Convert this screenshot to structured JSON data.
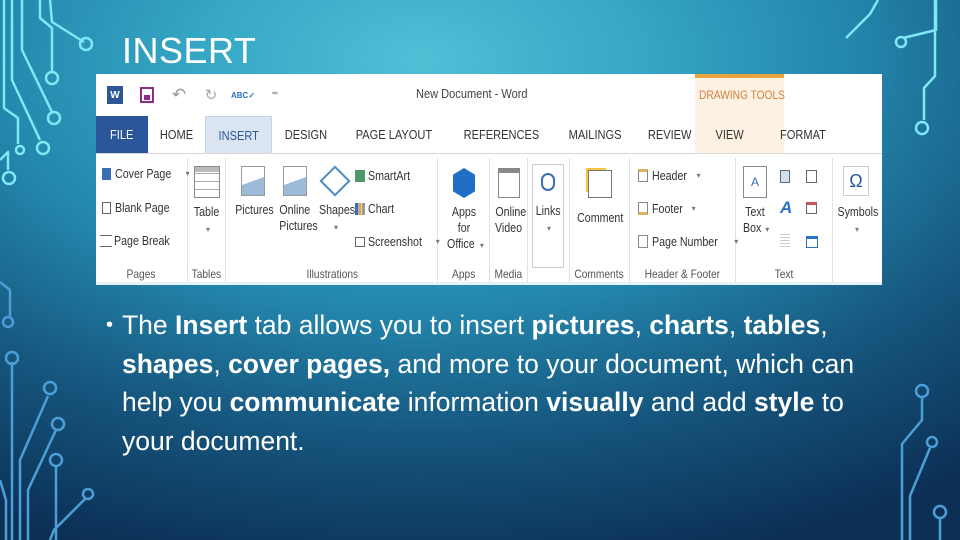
{
  "slide": {
    "title": "INSERT",
    "bullet": {
      "segments": [
        {
          "text": "The ",
          "bold": false
        },
        {
          "text": "Insert",
          "bold": true
        },
        {
          "text": " tab allows you to insert ",
          "bold": false
        },
        {
          "text": "pictures",
          "bold": true
        },
        {
          "text": ", ",
          "bold": false
        },
        {
          "text": "charts",
          "bold": true
        },
        {
          "text": ", ",
          "bold": false
        },
        {
          "text": "tables",
          "bold": true
        },
        {
          "text": ", ",
          "bold": false
        },
        {
          "text": "shapes",
          "bold": true
        },
        {
          "text": ", ",
          "bold": false
        },
        {
          "text": "cover pages,",
          "bold": true
        },
        {
          "text": " and more to your document, which can help you ",
          "bold": false
        },
        {
          "text": "communicate",
          "bold": true
        },
        {
          "text": " information ",
          "bold": false
        },
        {
          "text": "visually",
          "bold": true
        },
        {
          "text": " and add ",
          "bold": false
        },
        {
          "text": "style",
          "bold": true
        },
        {
          "text": " to your document.",
          "bold": false
        }
      ]
    },
    "colors": {
      "circuit_light": "#7ee8f5",
      "circuit_dark": "#4b9fd6",
      "title": "#ffffff"
    }
  },
  "word": {
    "window_title": "New Document - Word",
    "contextual_label": "DRAWING TOOLS",
    "qat": {
      "icons": [
        "word-logo-icon",
        "save-icon",
        "undo-icon",
        "redo-icon",
        "spelling-check-icon",
        "customize-qat-icon"
      ],
      "undo_glyph": "↶",
      "redo_glyph": "↻",
      "spell_glyph": "ABC✓",
      "more_glyph": "⁼"
    },
    "tabs": [
      "FILE",
      "HOME",
      "INSERT",
      "DESIGN",
      "PAGE LAYOUT",
      "REFERENCES",
      "MAILINGS",
      "REVIEW",
      "VIEW",
      "FORMAT"
    ],
    "active_tab": "INSERT",
    "colors": {
      "file_tab": "#2b579a",
      "active_tab_bg": "#dbe5f1",
      "contextual": "#e8a33a",
      "contextual_text": "#d3803a"
    },
    "groups": {
      "pages": {
        "label": "Pages",
        "items": [
          "Cover Page",
          "Blank Page",
          "Page Break"
        ]
      },
      "tables": {
        "label": "Tables",
        "table_label": "Table"
      },
      "illustrations": {
        "label": "Illustrations",
        "pictures": "Pictures",
        "online1": "Online",
        "online2": "Pictures",
        "shapes": "Shapes",
        "smartart": "SmartArt",
        "chart": "Chart",
        "screenshot": "Screenshot"
      },
      "apps": {
        "label": "Apps",
        "line1": "Apps for",
        "line2": "Office"
      },
      "media": {
        "label": "Media",
        "line1": "Online",
        "line2": "Video"
      },
      "links": {
        "label": "Links",
        "caption": "Links"
      },
      "comments": {
        "label": "Comments",
        "caption": "Comment"
      },
      "header_footer": {
        "label": "Header & Footer",
        "items": [
          "Header",
          "Footer",
          "Page Number"
        ]
      },
      "text": {
        "label": "Text",
        "line1": "Text",
        "line2": "Box"
      },
      "symbols": {
        "label": "Symbols",
        "glyph": "Ω"
      }
    },
    "dropdown_glyph": "▾"
  }
}
